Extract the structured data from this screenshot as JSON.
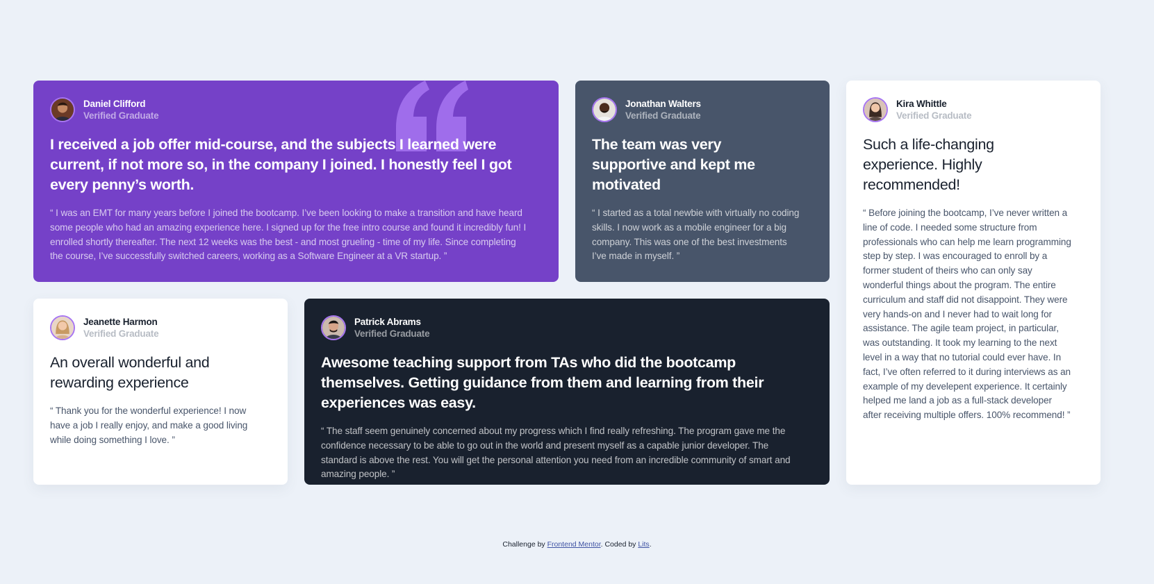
{
  "colors": {
    "background": "#ecf1f8",
    "moderate_violet": "#7541c8",
    "grayish_blue": "#48556a",
    "very_dark_blue": "#19212e",
    "white": "#ffffff",
    "avatar_ring": "#a775f1"
  },
  "testimonials": [
    {
      "name": "Daniel Clifford",
      "role": "Verified Graduate",
      "avatar": "avatar-daniel-icon",
      "headline": "I received a job offer mid-course, and the subjects I learned were current, if not more so, in the company I joined. I honestly feel I got every penny’s worth.",
      "body": "“ I was an EMT for many years before I joined the bootcamp. I’ve been looking to make a transition and have heard some people who had an amazing experience here. I signed up for the free intro course and found it incredibly fun! I enrolled shortly thereafter. The next 12 weeks was the best - and most grueling - time of my life. Since completing the course, I’ve successfully switched careers, working as a Software Engineer at a VR startup. ”"
    },
    {
      "name": "Jonathan Walters",
      "role": "Verified Graduate",
      "avatar": "avatar-jonathan-icon",
      "headline": "The team was very supportive and kept me motivated",
      "body": "“ I started as a total newbie with virtually no coding skills. I now work as a mobile engineer for a big company. This was one of the best investments I’ve made in myself. ”"
    },
    {
      "name": "Kira Whittle",
      "role": "Verified Graduate",
      "avatar": "avatar-kira-icon",
      "headline": "Such a life-changing experience. Highly recommended!",
      "body": "“ Before joining the bootcamp, I’ve never written a line of code. I needed some structure from professionals who can help me learn programming step by step. I was encouraged to enroll by a former student of theirs who can only say wonderful things about the program. The entire curriculum and staff did not disappoint. They were very hands-on and I never had to wait long for assistance. The agile team project, in particular, was outstanding. It took my learning to the next level in a way that no tutorial could ever have. In fact, I’ve often referred to it during interviews as an example of my develepent experience. It certainly helped me land a job as a full-stack developer after receiving multiple offers. 100% recommend! ”"
    },
    {
      "name": "Jeanette Harmon",
      "role": "Verified Graduate",
      "avatar": "avatar-jeanette-icon",
      "headline": "An overall wonderful and rewarding experience",
      "body": "“ Thank you for the wonderful experience! I now have a job I really enjoy, and make a good living while doing something I love. ”"
    },
    {
      "name": "Patrick Abrams",
      "role": "Verified Graduate",
      "avatar": "avatar-patrick-icon",
      "headline": "Awesome teaching support from TAs who did the bootcamp themselves. Getting guidance from them and learning from their experiences was easy.",
      "body": "“ The staff seem genuinely concerned about my progress which I find really refreshing. The program gave me the confidence necessary to be able to go out in the world and present myself as a capable junior developer. The standard is above the rest. You will get the personal attention you need from an incredible community of smart and amazing people. ”"
    }
  ],
  "decoration": {
    "quote_icon": "quotation-mark-icon"
  },
  "footer": {
    "prefix": "Challenge by ",
    "link1": "Frontend Mentor",
    "middle": ". Coded by ",
    "link2": "Lits",
    "suffix": "."
  }
}
